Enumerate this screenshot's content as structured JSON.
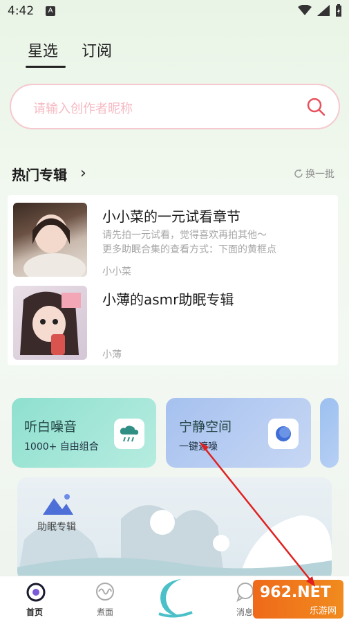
{
  "status_bar": {
    "time": "4:42",
    "notif_icon": "A"
  },
  "tabs": {
    "selected": "星选",
    "other": "订阅"
  },
  "search": {
    "placeholder": "请输入创作者昵称"
  },
  "hot_section": {
    "title": "热门专辑",
    "refresh_label": "换一批"
  },
  "albums": [
    {
      "name": "小小菜的一元试看章节",
      "desc_line1": "请先拍一元试看，觉得喜欢再拍其他～",
      "desc_line2": "更多助眠合集的查看方式：下面的黄框点",
      "author": "小小菜"
    },
    {
      "name": "小薄的asmr助眠专辑",
      "author": "小薄"
    }
  ],
  "cards": [
    {
      "title": "听白噪音",
      "subtitle": "1000+ 自由组合"
    },
    {
      "title": "宁静空间",
      "subtitle": "一键遮噪"
    }
  ],
  "banner": {
    "label": "助眠专辑"
  },
  "bottom_nav": {
    "home": "首页",
    "second": "煮面",
    "messages": "消息"
  },
  "watermark": {
    "main": "962.NET",
    "sub": "乐游网"
  },
  "colors": {
    "accent_pink": "#f5c9cf",
    "card_green": "#8fe0cf",
    "card_blue": "#a6c1ef",
    "arrow_red": "#e02020"
  }
}
